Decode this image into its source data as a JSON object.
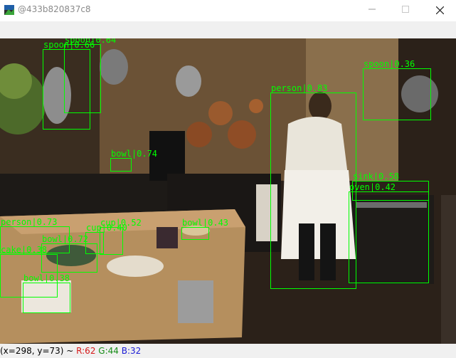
{
  "window": {
    "title": "@433b820837c8",
    "minimize_icon": "minimize-icon",
    "maximize_icon": "maximize-icon",
    "close_icon": "close-icon"
  },
  "status": {
    "coords": "(x=298, y=73) ~ ",
    "r": "R:62",
    "g": "G:44",
    "b": "B:32"
  },
  "colors": {
    "box": "#00ff00",
    "r": "#d61818",
    "g": "#168c16",
    "b": "#1a1ad6"
  },
  "detections": [
    {
      "label": "spoon|0.66"
    },
    {
      "label": "spoon|0.64"
    },
    {
      "label": "person|0.83"
    },
    {
      "label": "spoon|0.36"
    },
    {
      "label": "bowl|0.74"
    },
    {
      "label": "sink|0.58"
    },
    {
      "label": "oven|0.42"
    },
    {
      "label": "person|0.73"
    },
    {
      "label": "cup|0.52"
    },
    {
      "label": "cup|0.40"
    },
    {
      "label": "bowl|0.43"
    },
    {
      "label": "bowl|0.72"
    },
    {
      "label": "cake|0.38"
    },
    {
      "label": "bowl|0.38"
    }
  ]
}
